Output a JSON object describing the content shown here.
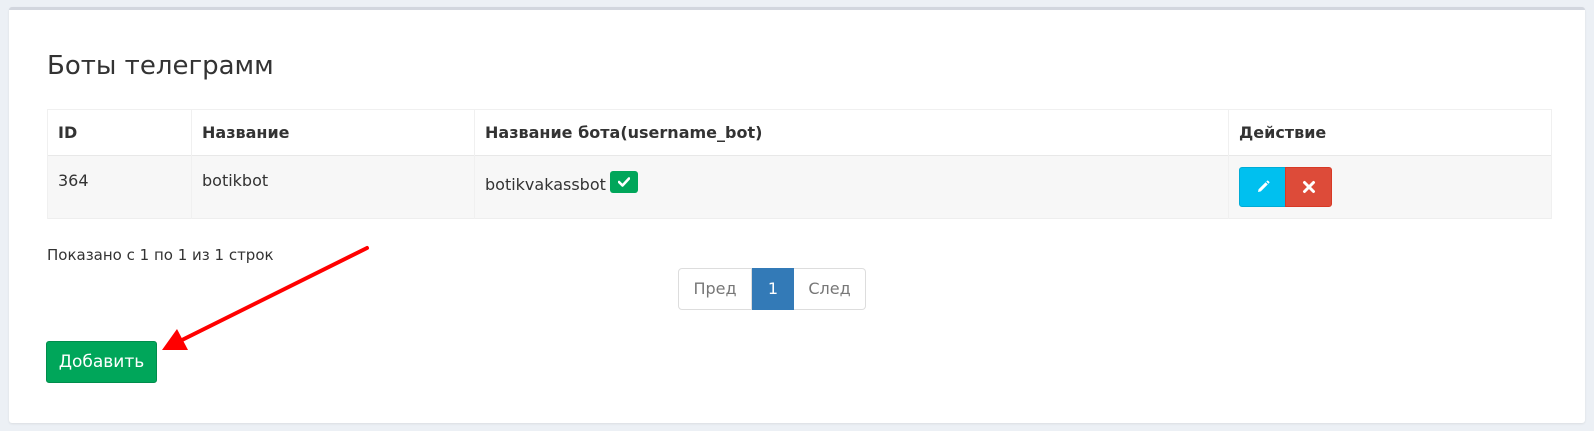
{
  "page": {
    "title": "Боты телеграмм"
  },
  "table": {
    "columns": [
      "ID",
      "Название",
      "Название бота(username_bot)",
      "Действие"
    ],
    "rows": [
      {
        "id": "364",
        "name": "botikbot",
        "username_bot": "botikvakassbot",
        "verified_icon": "check-icon"
      }
    ]
  },
  "footer": {
    "rows_info": "Показано с 1 по 1 из 1 строк"
  },
  "pagination": {
    "prev_label": "Пред",
    "current_page": "1",
    "next_label": "След"
  },
  "actions": {
    "add_label": "Добавить",
    "edit_icon": "pencil-icon",
    "delete_icon": "times-icon"
  },
  "colors": {
    "add_green": "#00a65a",
    "edit_cyan": "#00c0ef",
    "delete_red": "#dd4b39",
    "active_page_blue": "#337ab7",
    "annotation_arrow": "#ff0000"
  }
}
